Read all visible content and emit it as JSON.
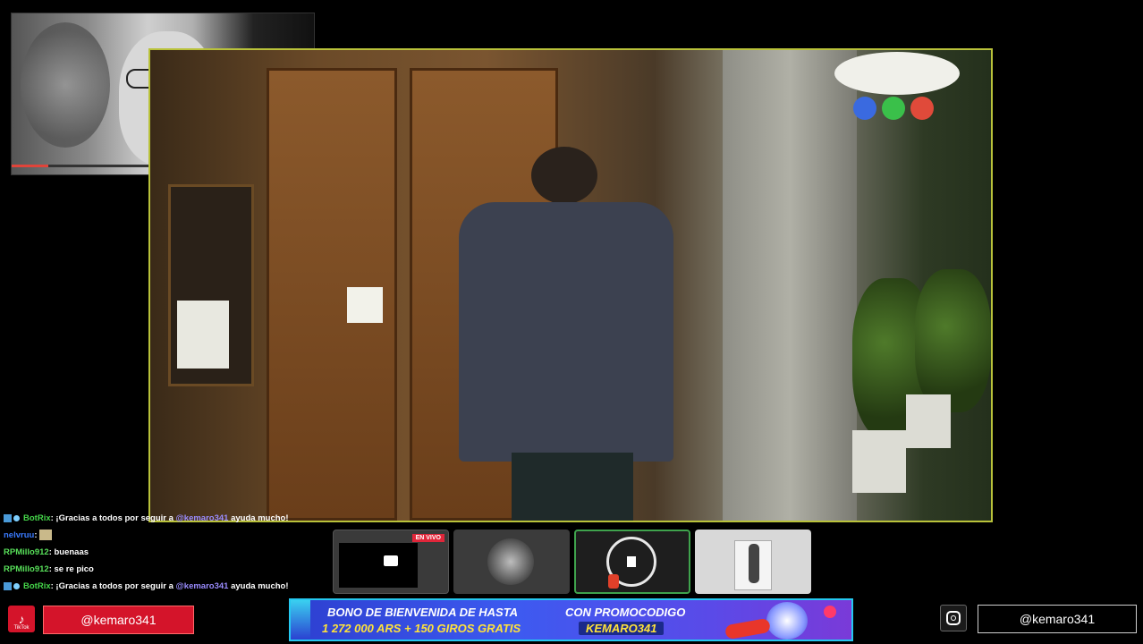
{
  "chat": {
    "messages": [
      {
        "user": "BotRix",
        "text_before": ": ¡Gracias a todos por seguir a ",
        "mention": "@kemaro341",
        "text_after": " ayuda mucho!"
      },
      {
        "user": "nelvruu",
        "text_before": ": ",
        "mention": "",
        "text_after": ""
      },
      {
        "user": "RPMillo912",
        "text_before": ": buenaas",
        "mention": "",
        "text_after": ""
      },
      {
        "user": "RPMillo912",
        "text_before": ": se re pico",
        "mention": "",
        "text_after": ""
      },
      {
        "user": "BotRix",
        "text_before": ": ¡Gracias a todos por seguir a ",
        "mention": "@kemaro341",
        "text_after": " ayuda mucho!"
      }
    ]
  },
  "thumbnails": {
    "live_badge": "EN VIVO"
  },
  "tiktok": {
    "icon_label": "TikTok",
    "handle": "@kemaro341",
    "accent": "#d4142a"
  },
  "instagram": {
    "handle": "@kemaro341"
  },
  "promo": {
    "line1_left": "BONO DE BIENVENIDA DE HASTA",
    "line2_left": "1 272 000 ARS + 150 GIROS GRATIS",
    "line1_right": "CON PROMOCODIGO",
    "code": "KEMARO341"
  },
  "icons": [
    "tiktok-icon",
    "instagram-icon",
    "monitor-icon"
  ],
  "colors": {
    "video_border": "#b9c23a",
    "banner_border": "#25c8f0",
    "active_thumb_border": "#3fa34d"
  }
}
